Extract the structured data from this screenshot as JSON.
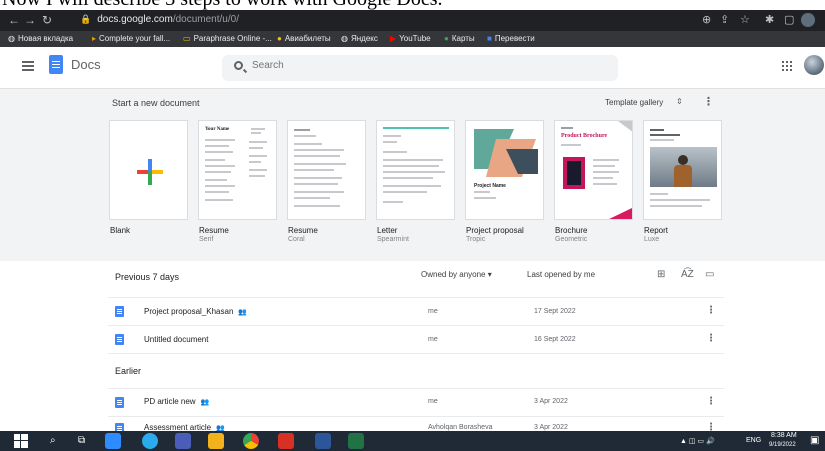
{
  "caption": "Now I will describe 3 steps to work with Google Docs.",
  "browser": {
    "url_domain": "docs.google.com",
    "url_path": "/document/u/0/",
    "bookmarks": [
      "Новая вкладка",
      "Complete your fall...",
      "Paraphrase Online -...",
      "Авиабилеты",
      "Яндекс",
      "YouTube",
      "Карты",
      "Перевести"
    ]
  },
  "app": {
    "title": "Docs",
    "search_placeholder": "Search"
  },
  "templates": {
    "heading": "Start a new document",
    "gallery_label": "Template gallery",
    "items": [
      {
        "name": "Blank",
        "sub": ""
      },
      {
        "name": "Resume",
        "sub": "Serif",
        "doc_title": "Your Name"
      },
      {
        "name": "Resume",
        "sub": "Coral"
      },
      {
        "name": "Letter",
        "sub": "Spearmint"
      },
      {
        "name": "Project proposal",
        "sub": "Tropic",
        "doc_title": "Project Name"
      },
      {
        "name": "Brochure",
        "sub": "Geometric",
        "doc_title": "Product Brochure"
      },
      {
        "name": "Report",
        "sub": "Luxe"
      }
    ]
  },
  "documents": {
    "recent_heading": "Previous 7 days",
    "owner_filter": "Owned by anyone",
    "sort_label": "Last opened by me",
    "earlier_heading": "Earlier",
    "recent": [
      {
        "name": "Project proposal_Khasan",
        "shared": true,
        "owner": "me",
        "date": "17 Sept 2022"
      },
      {
        "name": "Untitled document",
        "shared": false,
        "owner": "me",
        "date": "16 Sept 2022"
      }
    ],
    "earlier": [
      {
        "name": "PD article new",
        "shared": true,
        "owner": "me",
        "date": "3 Apr 2022"
      },
      {
        "name": "Assessment article",
        "shared": true,
        "owner": "Avholqan Borasheva",
        "date": "3 Apr 2022"
      }
    ]
  },
  "taskbar": {
    "lang": "ENG",
    "time": "8:38 AM",
    "date": "9/19/2022"
  }
}
